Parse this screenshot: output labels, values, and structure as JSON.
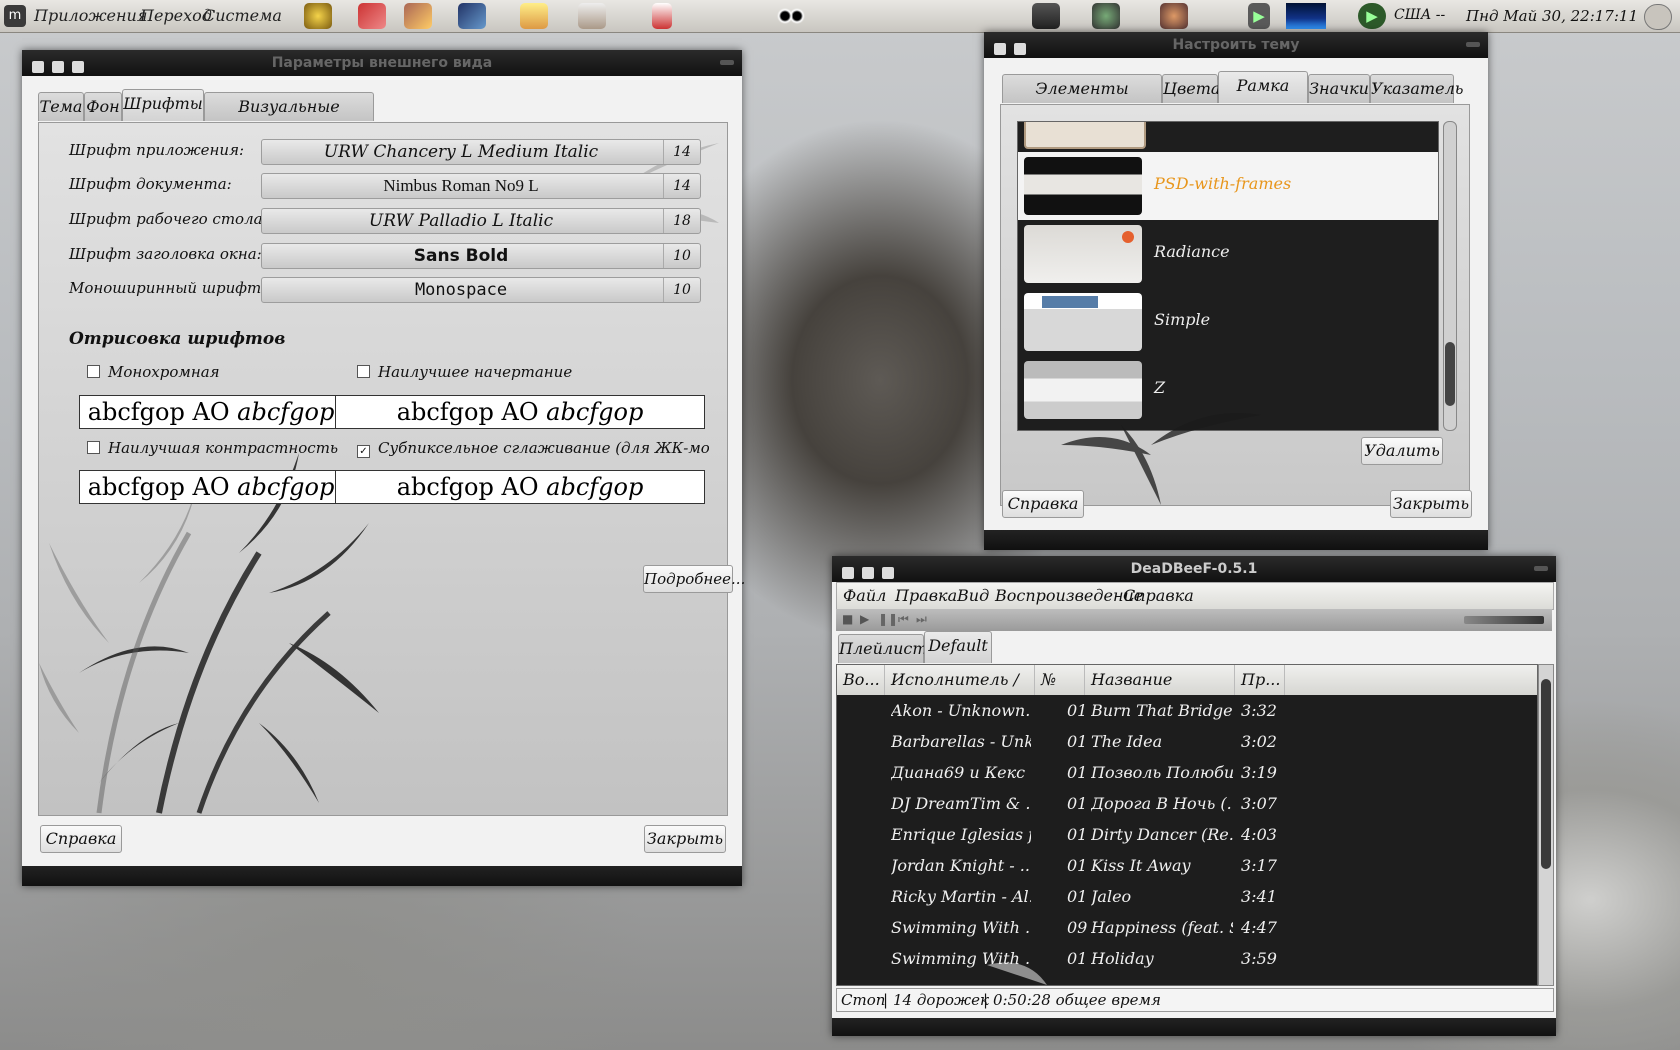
{
  "top_panel": {
    "menus": [
      "Приложения",
      "Переход",
      "Система"
    ],
    "keyboard_layout": "США --",
    "clock": "Пнд Май 30, 22:17:11"
  },
  "appearance_window": {
    "title": "Параметры внешнего вида",
    "tabs": [
      "Тема",
      "Фон",
      "Шрифты",
      "Визуальные эффекты"
    ],
    "active_tab": "Шрифты",
    "fonts": [
      {
        "label": "Шрифт приложения:",
        "font": "URW Chancery L Medium Italic",
        "size": "14"
      },
      {
        "label": "Шрифт документа:",
        "font": "Nimbus Roman No9 L",
        "size": "14"
      },
      {
        "label": "Шрифт рабочего стола:",
        "font": "URW Palladio L Italic",
        "size": "18"
      },
      {
        "label": "Шрифт заголовка окна:",
        "font": "Sans Bold",
        "size": "10"
      },
      {
        "label": "Моноширинный шрифт:",
        "font": "Monospace",
        "size": "10"
      }
    ],
    "rendering_heading": "Отрисовка шрифтов",
    "options": [
      {
        "label": "Монохромная",
        "checked": false
      },
      {
        "label": "Наилучшее начертание",
        "checked": false
      },
      {
        "label": "Наилучшая контрастность",
        "checked": false
      },
      {
        "label": "Субпиксельное сглаживание (для ЖК-мониторов)",
        "checked": true
      }
    ],
    "preview_plain": "abcfgop AO",
    "preview_italic": "abcfgop",
    "details_button": "Подробнее...",
    "help_button": "Справка",
    "close_button": "Закрыть"
  },
  "theme_window": {
    "title": "Настроить тему",
    "tabs": [
      "Элементы управления",
      "Цвета",
      "Рамка окна",
      "Значки",
      "Указатель"
    ],
    "active_tab": "Рамка окна",
    "themes": [
      "PSD-with-frames",
      "Radiance",
      "Simple",
      "Z"
    ],
    "selected_theme": "PSD-with-frames",
    "delete_button": "Удалить",
    "help_button": "Справка",
    "close_button": "Закрыть"
  },
  "deadbeef": {
    "title": "DeaDBeeF-0.5.1",
    "menu": [
      "Файл",
      "Правка",
      "Вид",
      "Воспроизведение",
      "Справка"
    ],
    "playlist_tabs": [
      "Плейлист",
      "Default"
    ],
    "columns": [
      "Во...",
      "Исполнитель / ...",
      "№",
      "Название",
      "Пр..."
    ],
    "tracks": [
      {
        "artist": "Akon - Unknown...",
        "num": "01",
        "title": "Burn That Bridge",
        "dur": "3:32"
      },
      {
        "artist": "Barbarellas - Unk...",
        "num": "01",
        "title": "The Idea",
        "dur": "3:02"
      },
      {
        "artist": "Диана69 и Кекс ...",
        "num": "01",
        "title": "Позволь Полюбить",
        "dur": "3:19"
      },
      {
        "artist": "DJ DreamTim & ...",
        "num": "01",
        "title": "Дорога В Ночь (...",
        "dur": "3:07"
      },
      {
        "artist": "Enrique Iglesias fe...",
        "num": "01",
        "title": "Dirty Dancer (Re...",
        "dur": "4:03"
      },
      {
        "artist": "Jordan Knight - ...",
        "num": "01",
        "title": "Kiss It Away",
        "dur": "3:17"
      },
      {
        "artist": "Ricky Martin - Al...",
        "num": "01",
        "title": "Jaleo",
        "dur": "3:41"
      },
      {
        "artist": "Swimming With ...",
        "num": "09",
        "title": "Happiness (feat. S...",
        "dur": "4:47"
      },
      {
        "artist": "Swimming With ...",
        "num": "01",
        "title": "Holiday",
        "dur": "3:59"
      }
    ],
    "status": {
      "state": "Стоп",
      "tracks": "14 дорожек",
      "total": "0:50:28 общее время"
    }
  }
}
